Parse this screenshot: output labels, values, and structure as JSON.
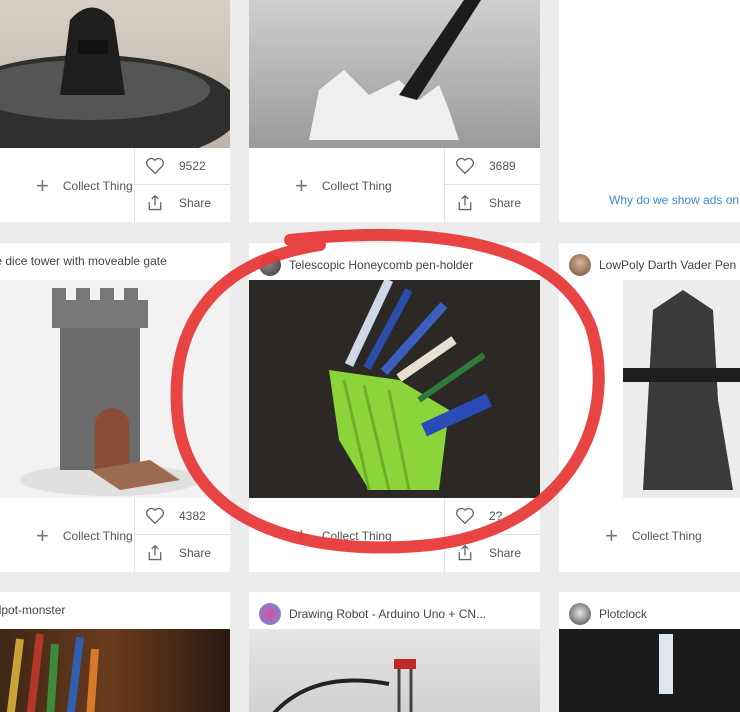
{
  "cards": [
    {
      "title": "",
      "like_count": "9522"
    },
    {
      "title": "",
      "like_count": "3689"
    },
    {
      "title": "Castle dice tower with moveable gate",
      "like_count": "4382"
    },
    {
      "title": "Telescopic Honeycomb pen-holder",
      "like_count": "2?"
    },
    {
      "title": "LowPoly Darth Vader Pen H",
      "like_count": ""
    },
    {
      "title": "pencilpot-monster"
    },
    {
      "title": "Drawing Robot - Arduino Uno + CN..."
    },
    {
      "title": "Plotclock"
    }
  ],
  "actions": {
    "collect": "Collect Thing",
    "share": "Share"
  },
  "ad_notice": "Why do we show ads on T",
  "icons": [
    "heart-icon",
    "share-icon",
    "plus-icon",
    "avatar"
  ],
  "annotation_color": "#e83a3a"
}
